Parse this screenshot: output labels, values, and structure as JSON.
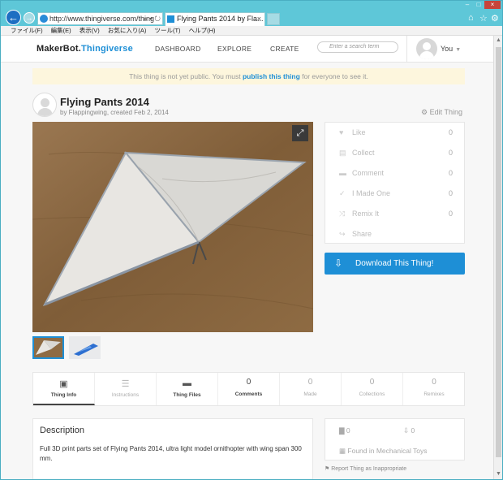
{
  "browser": {
    "address": "http://www.thingiverse.com/thing",
    "address_controls": "⌕ ▾ ↻",
    "tab_title": "Flying Pants 2014 by Fla...",
    "tab_close": "×",
    "right_icons": [
      "⌂",
      "☆",
      "⚙"
    ],
    "window_buttons": [
      "–",
      "□",
      "×"
    ]
  },
  "menubar": [
    "ファイル(F)",
    "編集(E)",
    "表示(V)",
    "お気に入り(A)",
    "ツール(T)",
    "ヘルプ(H)"
  ],
  "header": {
    "logo_makerbot": "MakerBot.",
    "logo_thingiverse": "Thingiverse",
    "nav": [
      "DASHBOARD",
      "EXPLORE",
      "CREATE"
    ],
    "search_placeholder": "Enter a search term",
    "user": "You"
  },
  "notice": {
    "before": "This thing is not yet public. You must ",
    "link": "publish this thing",
    "after": " for everyone to see it."
  },
  "thing": {
    "title": "Flying Pants 2014",
    "byline": "by Flappingwing, created Feb 2, 2014",
    "edit": "Edit Thing"
  },
  "stats": [
    {
      "icon": "♥",
      "label": "Like",
      "count": "0"
    },
    {
      "icon": "▤",
      "label": "Collect",
      "count": "0"
    },
    {
      "icon": "▬",
      "label": "Comment",
      "count": "0"
    },
    {
      "icon": "✓",
      "label": "I Made One",
      "count": "0"
    },
    {
      "icon": "⤨",
      "label": "Remix It",
      "count": "0"
    },
    {
      "icon": "↪",
      "label": "Share",
      "count": ""
    }
  ],
  "download": {
    "icon": "⇩",
    "label": "Download This Thing!"
  },
  "tabs": [
    {
      "icon": "▣",
      "num": "",
      "label": "Thing Info"
    },
    {
      "icon": "☰",
      "num": "",
      "label": "Instructions"
    },
    {
      "icon": "▬",
      "num": "",
      "label": "Thing Files"
    },
    {
      "icon": "",
      "num": "0",
      "label": "Comments"
    },
    {
      "icon": "",
      "num": "0",
      "label": "Made"
    },
    {
      "icon": "",
      "num": "0",
      "label": "Collections"
    },
    {
      "icon": "",
      "num": "0",
      "label": "Remixes"
    }
  ],
  "description": {
    "heading": "Description",
    "text": "Full 3D print parts set of Flying Pants 2014, ultra light model ornithopter with wing span 300 mm."
  },
  "side": {
    "views": "0",
    "downloads": "0",
    "found_in": "Found in Mechanical Toys",
    "report": "Report Thing as Inappropriate"
  },
  "colors": {
    "accent": "#1e8fd6",
    "notice_bg": "#fdf6dd",
    "chrome": "#5ec7d8"
  }
}
